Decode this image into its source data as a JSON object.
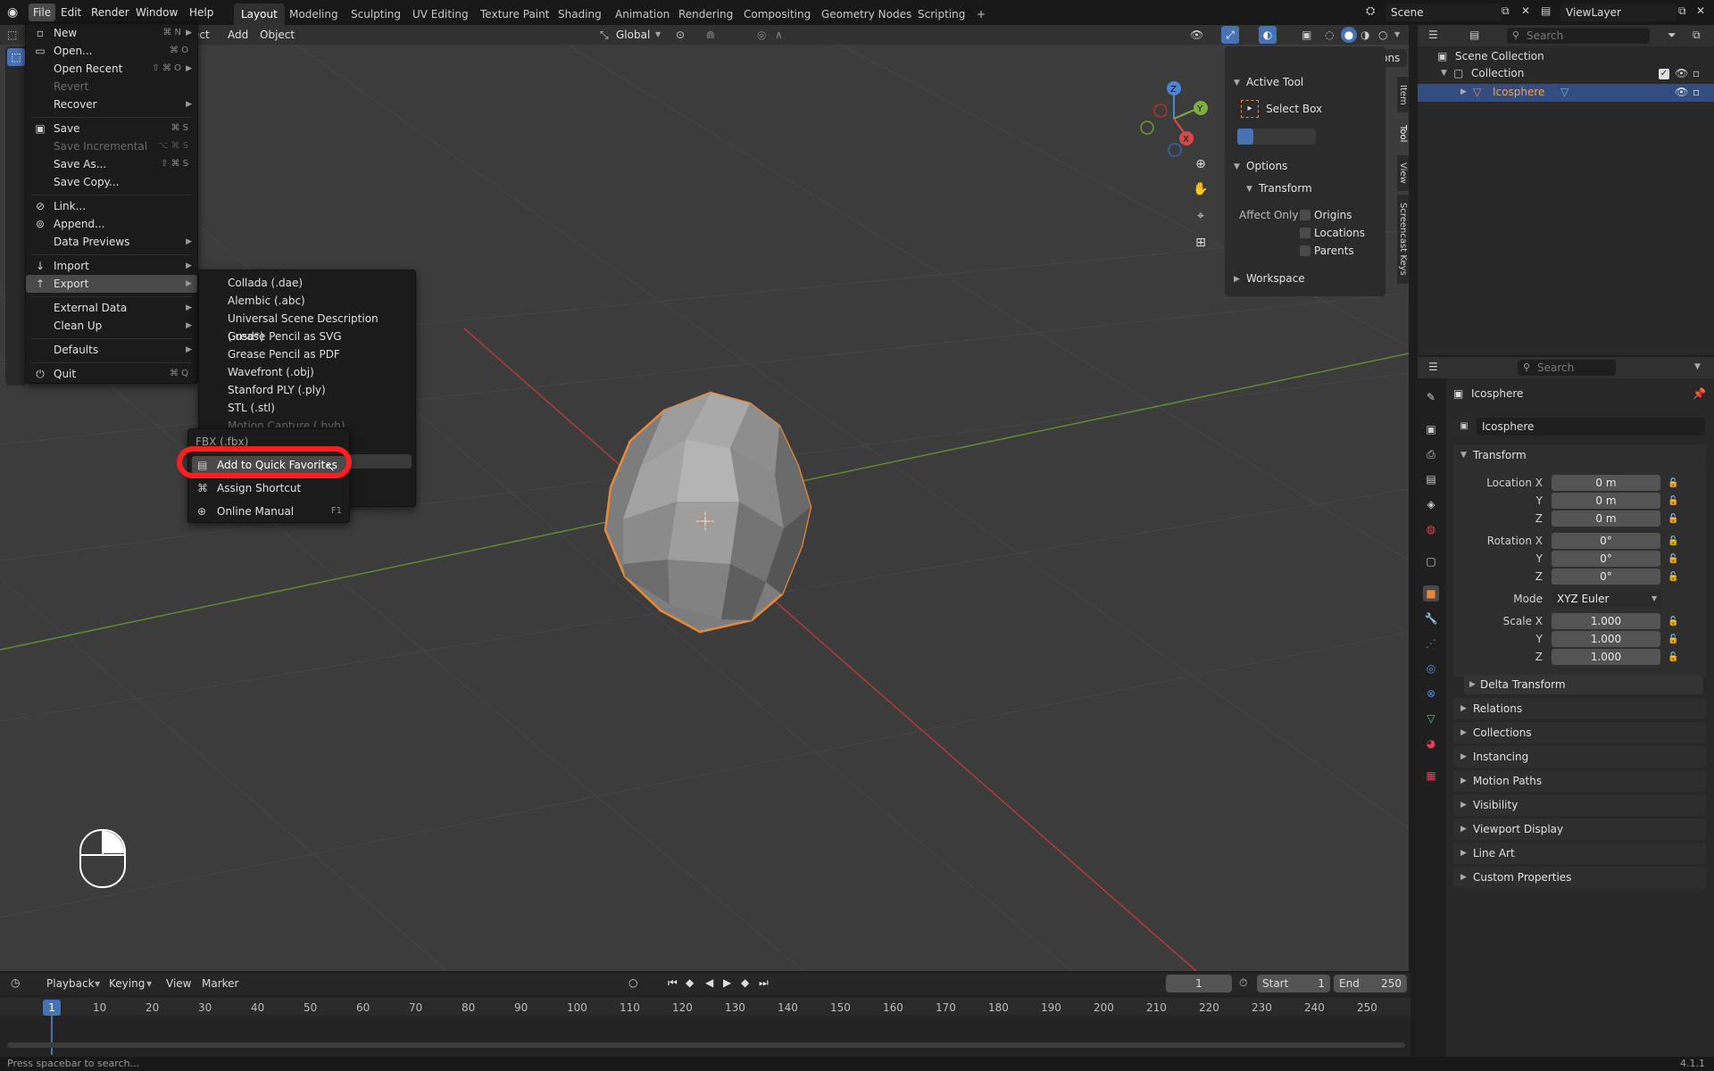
{
  "app": {
    "version": "4.1.1"
  },
  "topbar": {
    "menus": [
      "File",
      "Edit",
      "Render",
      "Window",
      "Help"
    ],
    "workspaces": [
      "Layout",
      "Modeling",
      "Sculpting",
      "UV Editing",
      "Texture Paint",
      "Shading",
      "Animation",
      "Rendering",
      "Compositing",
      "Geometry Nodes",
      "Scripting"
    ],
    "add_tab": "+",
    "scene": "Scene",
    "view_layer": "ViewLayer"
  },
  "viewport": {
    "header": {
      "partial_menu": "ect",
      "add": "Add",
      "object": "Object",
      "orientation": "Global",
      "options": "Options"
    },
    "npanel": {
      "active_tool_title": "Active Tool",
      "tool_name": "Select Box",
      "options_title": "Options",
      "transform_title": "Transform",
      "affect_only": "Affect Only",
      "origins": "Origins",
      "locations": "Locations",
      "parents": "Parents",
      "workspace_title": "Workspace"
    },
    "side_tabs": [
      "Item",
      "Tool",
      "View",
      "Screencast Keys"
    ],
    "gizmo": {
      "x": "X",
      "y": "Y",
      "z": "Z"
    }
  },
  "file_menu": {
    "items": [
      {
        "label": "New",
        "shortcut": "⌘ N",
        "icon": "▫",
        "arrow": true
      },
      {
        "label": "Open...",
        "shortcut": "⌘ O",
        "icon": "▭"
      },
      {
        "label": "Open Recent",
        "shortcut": "⇧ ⌘ O",
        "arrow": true
      },
      {
        "label": "Revert",
        "disabled": true
      },
      {
        "label": "Recover",
        "arrow": true
      },
      {
        "label": "Save",
        "shortcut": "⌘ S",
        "icon": "▣"
      },
      {
        "label": "Save Incremental",
        "shortcut": "⌥ ⌘ S",
        "disabled": true
      },
      {
        "label": "Save As...",
        "shortcut": "⇧ ⌘ S"
      },
      {
        "label": "Save Copy..."
      },
      {
        "label": "Link...",
        "icon": "⊘"
      },
      {
        "label": "Append...",
        "icon": "⊚"
      },
      {
        "label": "Data Previews",
        "arrow": true
      },
      {
        "label": "Import",
        "icon": "↓",
        "arrow": true
      },
      {
        "label": "Export",
        "icon": "↑",
        "arrow": true
      },
      {
        "label": "External Data",
        "arrow": true
      },
      {
        "label": "Clean Up",
        "arrow": true
      },
      {
        "label": "Defaults",
        "arrow": true
      },
      {
        "label": "Quit",
        "shortcut": "⌘ Q",
        "icon": "⏻"
      }
    ]
  },
  "export_menu": {
    "items": [
      "Collada (.dae)",
      "Alembic (.abc)",
      "Universal Scene Description (.usd*)",
      "Grease Pencil as SVG",
      "Grease Pencil as PDF",
      "Wavefront (.obj)",
      "Stanford PLY (.ply)",
      "STL (.stl)",
      "Motion Capture (.bvh)"
    ]
  },
  "context_menu": {
    "title": "FBX (.fbx)",
    "add_fav": "Add to Quick Favorites",
    "assign_shortcut": "Assign Shortcut",
    "online_manual": "Online Manual",
    "online_manual_key": "F1"
  },
  "outliner": {
    "search_placeholder": "Search",
    "scene_collection": "Scene Collection",
    "collection": "Collection",
    "object": "Icosphere"
  },
  "properties": {
    "search_placeholder": "Search",
    "object_title": "Icosphere",
    "object_name": "Icosphere",
    "transform_title": "Transform",
    "location_x_label": "Location X",
    "y_label": "Y",
    "z_label": "Z",
    "rotation_x_label": "Rotation X",
    "scale_x_label": "Scale X",
    "mode_label": "Mode",
    "location": [
      "0 m",
      "0 m",
      "0 m"
    ],
    "rotation": [
      "0°",
      "0°",
      "0°"
    ],
    "rotation_mode": "XYZ Euler",
    "scale": [
      "1.000",
      "1.000",
      "1.000"
    ],
    "delta_transform": "Delta Transform",
    "sections": [
      "Relations",
      "Collections",
      "Instancing",
      "Motion Paths",
      "Visibility",
      "Viewport Display",
      "Line Art",
      "Custom Properties"
    ]
  },
  "timeline": {
    "playback": "Playback",
    "keying": "Keying",
    "view": "View",
    "marker": "Marker",
    "current_frame": "1",
    "start_label": "Start",
    "start": "1",
    "end_label": "End",
    "end": "250",
    "ruler": [
      "10",
      "20",
      "30",
      "40",
      "50",
      "60",
      "70",
      "80",
      "90",
      "100",
      "110",
      "120",
      "130",
      "140",
      "150",
      "160",
      "170",
      "180",
      "190",
      "200",
      "210",
      "220",
      "230",
      "240",
      "250"
    ],
    "playhead": "1"
  },
  "status": {
    "hint": "Press spacebar to search..."
  },
  "colors": {
    "accent": "#4772b3",
    "selection_orange": "#e8893a",
    "highlight_red": "#ff1f1f"
  }
}
